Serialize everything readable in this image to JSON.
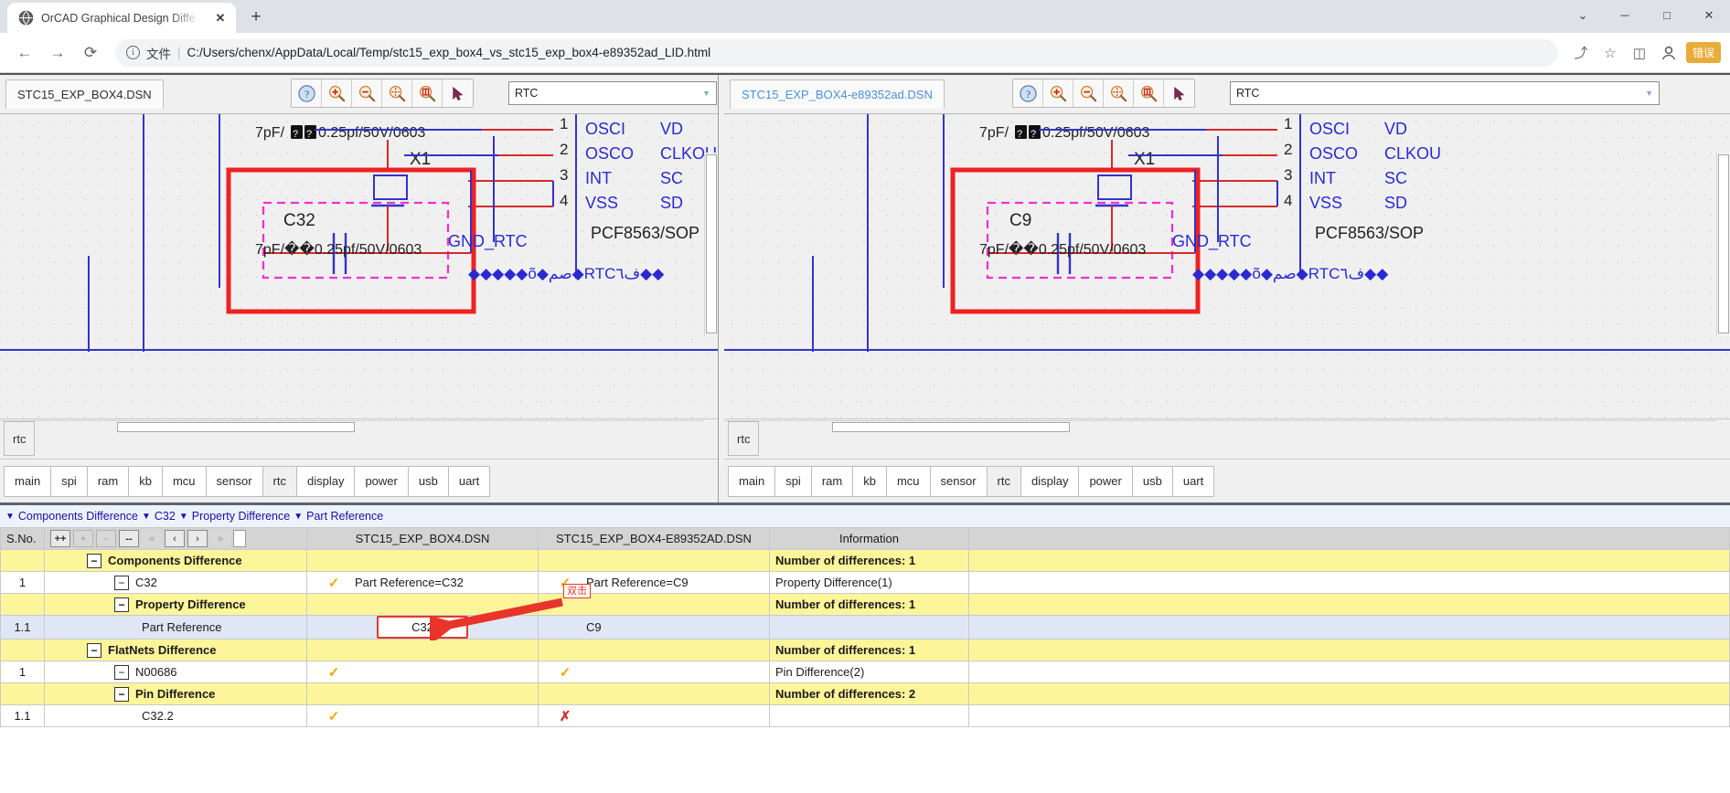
{
  "browser": {
    "tab_title": "OrCAD Graphical Design Diffe",
    "new_tab_label": "+",
    "close_label": "✕",
    "window_controls": {
      "minimize": "─",
      "maximize": "□",
      "chevron": "⌄"
    },
    "nav": {
      "back": "←",
      "forward": "→",
      "reload": "⟳"
    },
    "omnibox": {
      "info_icon": "i",
      "scheme_label": "文件",
      "separator": "|",
      "url": "C:/Users/chenx/AppData/Local/Temp/stc15_exp_box4_vs_stc15_exp_box4-e89352ad_LID.html"
    },
    "actions": {
      "share": "⤴",
      "bookmark": "☆",
      "sidepanel": "◫",
      "profile": "●"
    },
    "error_badge": "错误"
  },
  "panes": {
    "left": {
      "dsn_tab": "STC15_EXP_BOX4.DSN",
      "combo_value": "RTC",
      "sheet_title": "rtc",
      "toolbar": [
        {
          "name": "help-icon",
          "glyph": "?"
        },
        {
          "name": "zoom-in-icon",
          "glyph": "+"
        },
        {
          "name": "zoom-out-icon",
          "glyph": "−"
        },
        {
          "name": "zoom-fit-icon",
          "glyph": "✥"
        },
        {
          "name": "zoom-region-icon",
          "glyph": "⬚"
        },
        {
          "name": "select-cursor-icon",
          "glyph": "➤"
        }
      ],
      "schematic": {
        "cap_value": "7pF/��0.25pf/50V/0603",
        "cap_value2": "7pF/��0.25pf/50V/0603",
        "xtal_ref": "X1",
        "cap_ref": "C32",
        "net_label": "GND_RTC",
        "part_label": "PCF8563/SOP",
        "garbled_net": "������õ�صم�RTCف٦��",
        "pin_numbers": [
          "1",
          "2",
          "3",
          "4"
        ],
        "pin_names_left": [
          "OSCI",
          "OSCO",
          "INT",
          "VSS"
        ],
        "pin_names_right": [
          "VD",
          "CLKOU",
          "SC",
          "SD"
        ]
      },
      "sheet_tabs": [
        "main",
        "spi",
        "ram",
        "kb",
        "mcu",
        "sensor",
        "rtc",
        "display",
        "power",
        "usb",
        "uart"
      ],
      "active_sheet_tab": "rtc"
    },
    "right": {
      "dsn_tab": "STC15_EXP_BOX4-e89352ad.DSN",
      "combo_value": "RTC",
      "sheet_title": "rtc",
      "toolbar": [
        {
          "name": "help-icon",
          "glyph": "?"
        },
        {
          "name": "zoom-in-icon",
          "glyph": "+"
        },
        {
          "name": "zoom-out-icon",
          "glyph": "−"
        },
        {
          "name": "zoom-fit-icon",
          "glyph": "✥"
        },
        {
          "name": "zoom-region-icon",
          "glyph": "⬚"
        },
        {
          "name": "select-cursor-icon",
          "glyph": "➤"
        }
      ],
      "schematic": {
        "cap_value": "7pF/��0.25pf/50V/0603",
        "cap_value2": "7pF/��0.25pf/50V/0603",
        "xtal_ref": "X1",
        "cap_ref": "C9",
        "net_label": "GND_RTC",
        "part_label": "PCF8563/SOP",
        "garbled_net": "������õ�صم�RTCف٦��",
        "pin_numbers": [
          "1",
          "2",
          "3",
          "4"
        ],
        "pin_names_left": [
          "OSCI",
          "OSCO",
          "INT",
          "VSS"
        ],
        "pin_names_right": [
          "VD",
          "CLKOU",
          "SC",
          "SD"
        ]
      },
      "sheet_tabs": [
        "main",
        "spi",
        "ram",
        "kb",
        "mcu",
        "sensor",
        "rtc",
        "display",
        "power",
        "usb",
        "uart"
      ],
      "active_sheet_tab": "rtc"
    }
  },
  "breadcrumb": {
    "items": [
      {
        "arrow": "▼",
        "label": "Components Difference"
      },
      {
        "arrow": "▼",
        "label": "C32"
      },
      {
        "arrow": "▼",
        "label": "Property Difference"
      },
      {
        "arrow": "▼",
        "label": "Part Reference"
      }
    ]
  },
  "table": {
    "headers": {
      "sno": "S.No.",
      "design_a": "STC15_EXP_BOX4.DSN",
      "design_b": "STC15_EXP_BOX4-E89352AD.DSN",
      "information": "Information"
    },
    "nav_buttons": [
      {
        "name": "expand-all-button",
        "label": "++",
        "state": "enabled"
      },
      {
        "name": "expand-one-button",
        "label": "+",
        "state": "disabled"
      },
      {
        "name": "collapse-one-button",
        "label": "-",
        "state": "disabled"
      },
      {
        "name": "collapse-all-button",
        "label": "--",
        "state": "enabled"
      },
      {
        "name": "first-button",
        "label": "«",
        "state": "disabled"
      },
      {
        "name": "prev-button",
        "label": "‹",
        "state": "enabled"
      },
      {
        "name": "next-button",
        "label": "›",
        "state": "enabled"
      },
      {
        "name": "last-button",
        "label": "»",
        "state": "disabled"
      },
      {
        "name": "slider-handle",
        "label": "",
        "state": "enabled"
      }
    ],
    "rows": [
      {
        "kind": "group",
        "indent": 1,
        "expander": "−",
        "sno": "",
        "label": "Components Difference",
        "a_mark": "",
        "a_text": "",
        "b_mark": "",
        "b_text": "",
        "info": "Number of differences: 1",
        "info_bold": true
      },
      {
        "kind": "normal",
        "indent": 2,
        "expander": "−",
        "sno": "1",
        "label": "C32",
        "a_mark": "check",
        "a_text": "Part Reference=C32",
        "b_mark": "check",
        "b_text": "Part Reference=C9",
        "info": "Property Difference(1)",
        "info_bold": false
      },
      {
        "kind": "group",
        "indent": 2,
        "expander": "−",
        "sno": "",
        "label": "Property Difference",
        "a_mark": "",
        "a_text": "",
        "b_mark": "",
        "b_text": "",
        "info": "Number of differences: 1",
        "info_bold": true
      },
      {
        "kind": "highlight",
        "indent": 3,
        "expander": "",
        "sno": "1.1",
        "label": "Part Reference",
        "a_mark": "",
        "a_text": "C32",
        "a_boxed": true,
        "b_mark": "",
        "b_text": "C9",
        "info": "",
        "info_bold": false
      },
      {
        "kind": "group",
        "indent": 1,
        "expander": "−",
        "sno": "",
        "label": "FlatNets Difference",
        "a_mark": "",
        "a_text": "",
        "b_mark": "",
        "b_text": "",
        "info": "Number of differences: 1",
        "info_bold": true
      },
      {
        "kind": "normal",
        "indent": 2,
        "expander": "−",
        "sno": "1",
        "label": "N00686",
        "a_mark": "check",
        "a_text": "",
        "b_mark": "check",
        "b_text": "",
        "info": "Pin Difference(2)",
        "info_bold": false
      },
      {
        "kind": "group",
        "indent": 2,
        "expander": "−",
        "sno": "",
        "label": "Pin Difference",
        "a_mark": "",
        "a_text": "",
        "b_mark": "",
        "b_text": "",
        "info": "Number of differences: 2",
        "info_bold": true
      },
      {
        "kind": "normal",
        "indent": 3,
        "expander": "",
        "sno": "1.1",
        "label": "C32.2",
        "a_mark": "check",
        "a_text": "",
        "b_mark": "x",
        "b_text": "",
        "info": "",
        "info_bold": false
      }
    ]
  },
  "annotation": {
    "label": "双击",
    "arrow_color": "#e8342a",
    "highlight_box_color": "#e03a2f"
  },
  "colors": {
    "group_row_bg": "#fdf59a",
    "highlight_row_bg": "#dfe7f6",
    "header_bg": "#d4d4d4",
    "check_color": "#f0a500",
    "x_color": "#d32f2f",
    "schematic_wire_blue": "#3333cc",
    "schematic_wire_red": "#d42a2a",
    "schematic_highlight_red": "#ee2222",
    "schematic_highlight_magenta": "#ee33cc",
    "link_color": "#1a0dab"
  }
}
